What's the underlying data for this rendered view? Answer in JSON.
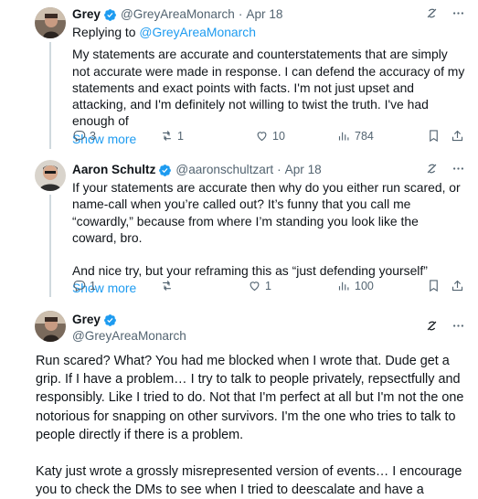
{
  "tweets": [
    {
      "name": "Grey",
      "handle": "@GreyAreaMonarch",
      "sep": "·",
      "date": "Apr 18",
      "replying_prefix": "Replying to ",
      "replying_handle": "@GreyAreaMonarch",
      "text": "My statements are accurate and counterstatements that are simply not accurate were made in response. I can defend the accuracy of my statements and exact points with facts. I'm not just upset and attacking, and I'm definitely not willing to twist the truth. I've had enough of",
      "show_more": "Show more",
      "replies": "3",
      "retweets": "1",
      "likes": "10",
      "views": "784"
    },
    {
      "name": "Aaron Schultz",
      "handle": "@aaronschultzart",
      "sep": "·",
      "date": "Apr 18",
      "text_p1": "If your statements are accurate then why do you either run scared, or name-call when you’re called out? It’s funny that you call me “cowardly,” because from where I’m standing you look like the coward, bro.",
      "text_p2": "And nice try, but your reframing this as “just defending yourself”",
      "show_more": "Show more",
      "replies": "1",
      "retweets": "",
      "likes": "1",
      "views": "100"
    },
    {
      "name": "Grey",
      "handle": "@GreyAreaMonarch",
      "text_p1": "Run scared? What? You had me blocked when I wrote that. Dude get a grip. If I have a problem… I try to talk to people privately, repsectfully and responsibly. Like I tried to do. Not that I'm perfect at all but I'm not the one notorious for snapping on other survivors. I'm the one who tries to talk to people directly if there is a problem.",
      "text_p2": "Katy just wrote a grossly misrepresented version of events… I encourage you to check the DMs to see when I tried to deescalate and have a"
    }
  ],
  "colors": {
    "accent": "#1d9bf0",
    "muted": "#536471",
    "text": "#0f1419",
    "divider": "#eff3f4"
  },
  "icons": [
    "verified-badge-icon",
    "grok-icon",
    "more-icon",
    "reply-icon",
    "retweet-icon",
    "like-icon",
    "views-icon",
    "bookmark-icon",
    "share-icon"
  ]
}
